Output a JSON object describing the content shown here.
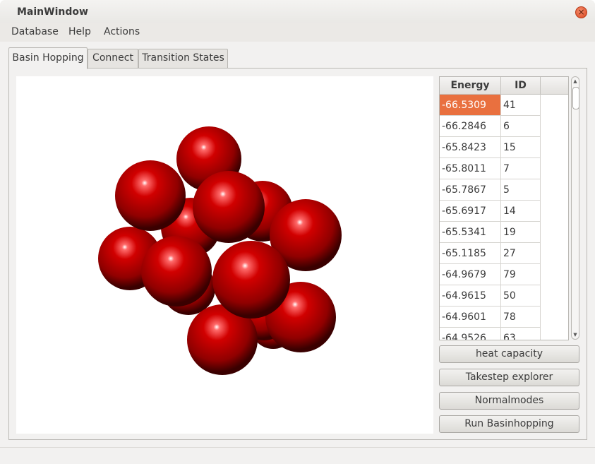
{
  "window": {
    "title": "MainWindow"
  },
  "menu": {
    "items": [
      "Database",
      "Help",
      "Actions"
    ]
  },
  "tabs": [
    {
      "label": "Basin Hopping",
      "active": true
    },
    {
      "label": "Connect",
      "active": false
    },
    {
      "label": "Transition States",
      "active": false
    }
  ],
  "table": {
    "headers": {
      "energy": "Energy",
      "id": "ID"
    },
    "rows": [
      {
        "energy": "-66.5309",
        "id": "41",
        "selected": true
      },
      {
        "energy": "-66.2846",
        "id": "6"
      },
      {
        "energy": "-65.8423",
        "id": "15"
      },
      {
        "energy": "-65.8011",
        "id": "7"
      },
      {
        "energy": "-65.7867",
        "id": "5"
      },
      {
        "energy": "-65.6917",
        "id": "14"
      },
      {
        "energy": "-65.5341",
        "id": "19"
      },
      {
        "energy": "-65.1185",
        "id": "27"
      },
      {
        "energy": "-64.9679",
        "id": "79"
      },
      {
        "energy": "-64.9615",
        "id": "50"
      },
      {
        "energy": "-64.9601",
        "id": "78"
      },
      {
        "energy": "-64.9526",
        "id": "63"
      }
    ]
  },
  "buttons": {
    "heat_capacity": "heat capacity",
    "takestep_explorer": "Takestep explorer",
    "normalmodes": "Normalmodes",
    "run_basinhopping": "Run Basinhopping"
  },
  "icons": {
    "close": "close-icon",
    "scroll_up": "chevron-up-icon",
    "scroll_down": "chevron-down-icon"
  },
  "colors": {
    "selection": "#e9703f",
    "sphere": "#c00000",
    "close": "#d9461f"
  }
}
